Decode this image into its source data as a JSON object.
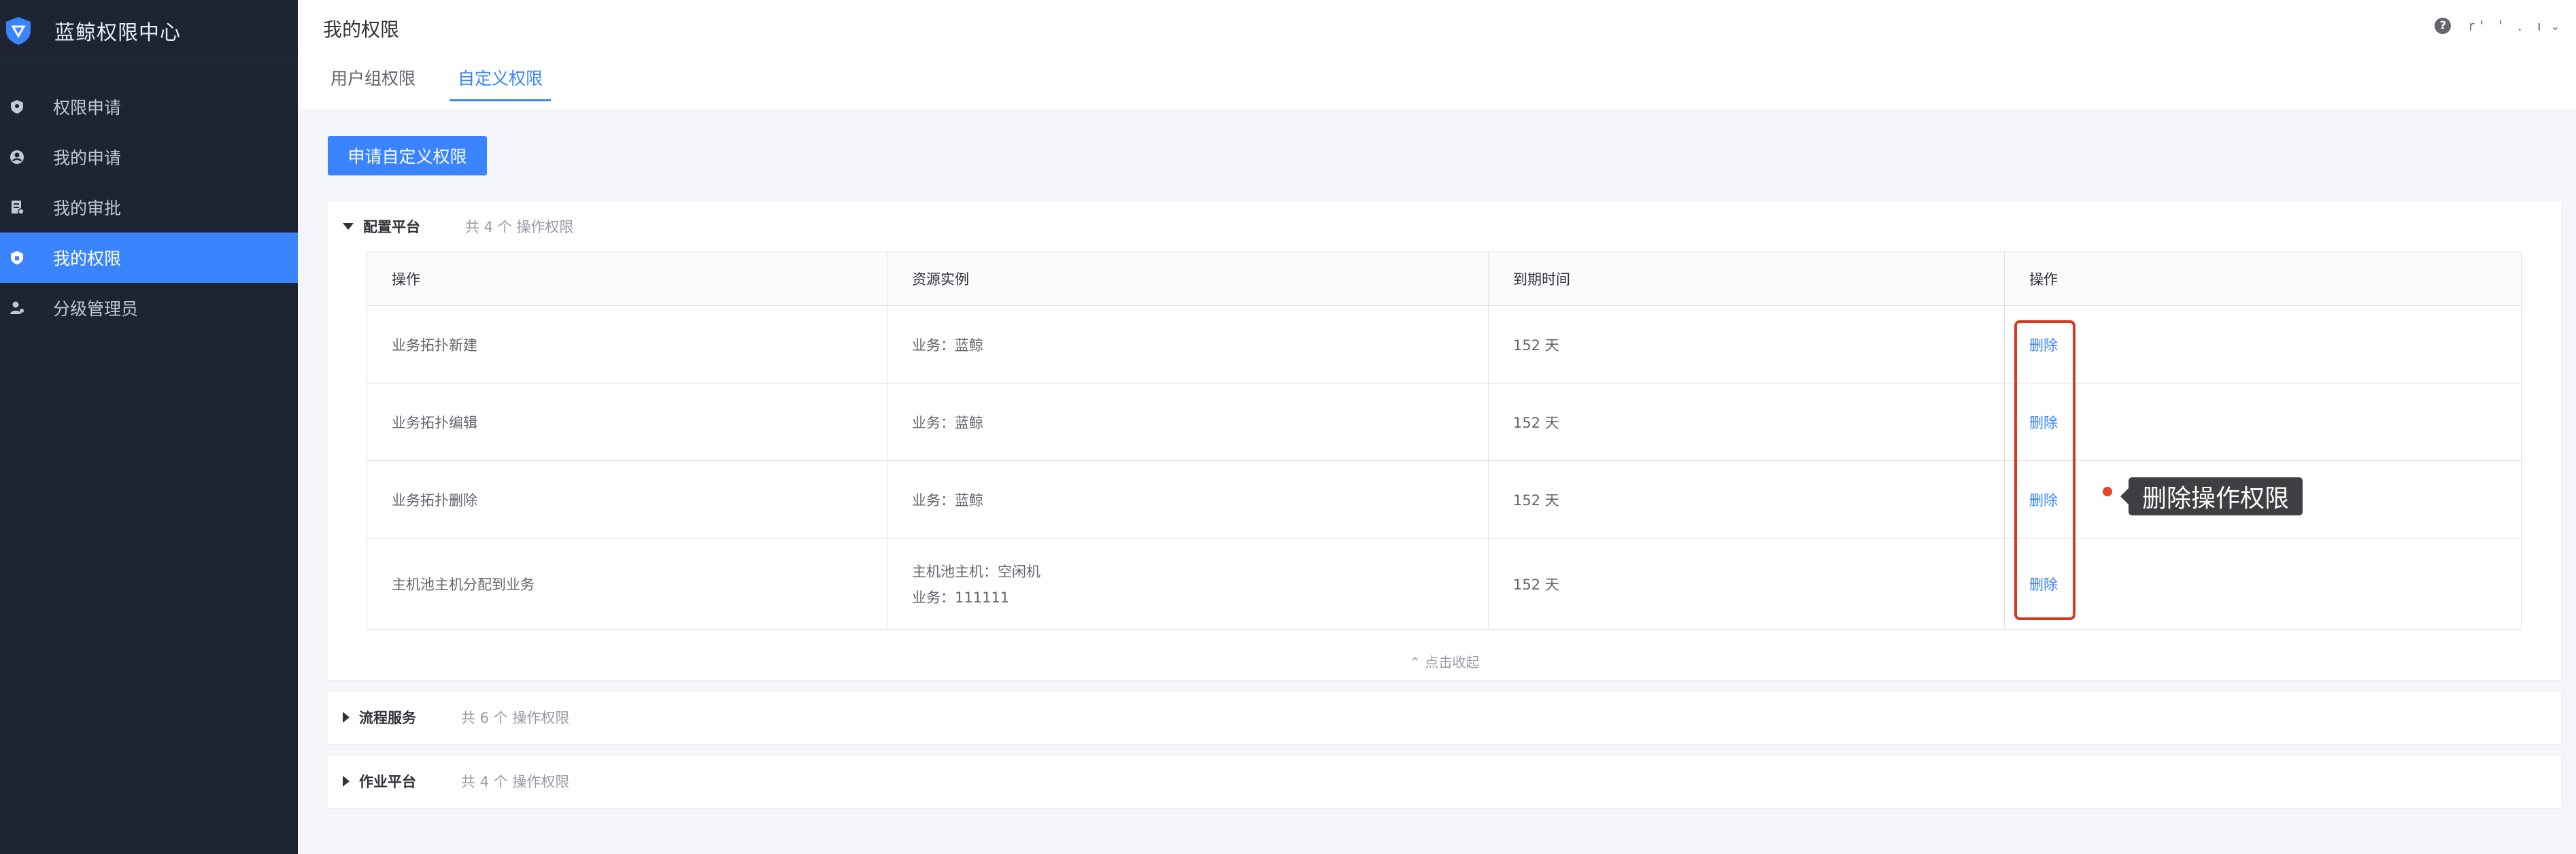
{
  "app": {
    "title": "蓝鲸权限中心"
  },
  "sidebar": {
    "items": [
      {
        "label": "权限申请",
        "icon": "shield-icon",
        "active": false
      },
      {
        "label": "我的申请",
        "icon": "user-circle-icon",
        "active": false
      },
      {
        "label": "我的审批",
        "icon": "document-icon",
        "active": false
      },
      {
        "label": "我的权限",
        "icon": "shield-lock-icon",
        "active": true
      },
      {
        "label": "分级管理员",
        "icon": "user-admin-icon",
        "active": false
      }
    ]
  },
  "header": {
    "title": "我的权限",
    "username": "r' ' .  ı",
    "tabs": [
      {
        "label": "用户组权限",
        "active": false
      },
      {
        "label": "自定义权限",
        "active": true
      }
    ]
  },
  "main": {
    "apply_button": "申请自定义权限",
    "collapse_label": "⌃ 点击收起",
    "panels": [
      {
        "name": "配置平台",
        "count": "共 4 个 操作权限",
        "expanded": true,
        "columns": [
          "操作",
          "资源实例",
          "到期时间",
          "操作"
        ],
        "rows": [
          {
            "action": "业务拓扑新建",
            "resource": [
              "业务：蓝鲸"
            ],
            "expire": "152 天",
            "op": "删除"
          },
          {
            "action": "业务拓扑编辑",
            "resource": [
              "业务：蓝鲸"
            ],
            "expire": "152 天",
            "op": "删除"
          },
          {
            "action": "业务拓扑删除",
            "resource": [
              "业务：蓝鲸"
            ],
            "expire": "152 天",
            "op": "删除"
          },
          {
            "action": "主机池主机分配到业务",
            "resource": [
              "主机池主机：空闲机",
              "业务：111111"
            ],
            "expire": "152 天",
            "op": "删除"
          }
        ]
      },
      {
        "name": "流程服务",
        "count": "共 6 个 操作权限",
        "expanded": false
      },
      {
        "name": "作业平台",
        "count": "共 4 个 操作权限",
        "expanded": false
      }
    ]
  },
  "annotation": {
    "label": "删除操作权限"
  },
  "colors": {
    "primary": "#3a84ff",
    "sidebar_bg": "#1f2433",
    "annotation_red": "#d9391e"
  }
}
